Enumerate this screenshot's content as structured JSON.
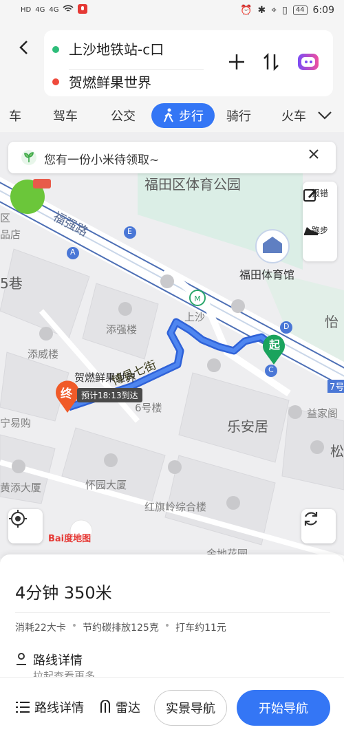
{
  "status_bar": {
    "left_indicators": [
      "HD",
      "4G",
      "4G"
    ],
    "time": "6:09",
    "battery": "44"
  },
  "route": {
    "origin": "上沙地铁站-c口",
    "destination": "贺燃鲜果世界"
  },
  "tabs": [
    "车",
    "驾车",
    "公交",
    "步行",
    "骑行",
    "火车"
  ],
  "active_tab": "步行",
  "map": {
    "banner": "您有一份小米待领取~",
    "tools": {
      "report": "报错",
      "run": "跑步"
    },
    "labels": {
      "park": "福田区体育公园",
      "road1": "福强路",
      "stadium": "福田体育馆",
      "station": "上沙",
      "b1": "添强楼",
      "b2": "添威楼",
      "dest_name": "贺燃鲜果世界",
      "street": "博县七街",
      "b3": "6号楼",
      "b4": "乐安居",
      "b5": "益家阁",
      "b6": "怀园大厦",
      "b7": "红旗岭综合楼",
      "b8": "宁易购",
      "b9": "黄添大厦",
      "b10": "怡",
      "b11": "5巷",
      "b12": "区",
      "b13": "品店",
      "b14": "金地花园",
      "b15": "松",
      "b16": "7号",
      "start_marker": "起",
      "end_marker": "终",
      "exit_a": "A",
      "exit_c": "C",
      "exit_d": "D",
      "exit_e": "E"
    },
    "eta": "预计18:13到达",
    "logo_text": "Bai度地图"
  },
  "summary": {
    "time_distance": "4分钟  350米",
    "calories": "消耗22大卡",
    "carbon": "节约碳排放125克",
    "taxi": "打车约11元"
  },
  "details": {
    "title": "路线详情",
    "subtitle": "拉起查看更多"
  },
  "bottom_bar": {
    "details_label": "路线详情",
    "radar_label": "雷达",
    "live_nav": "实景导航",
    "start_nav": "开始导航"
  },
  "colors": {
    "accent": "#3476f5",
    "start_green": "#1aa35d",
    "end_orange": "#f05a28"
  }
}
